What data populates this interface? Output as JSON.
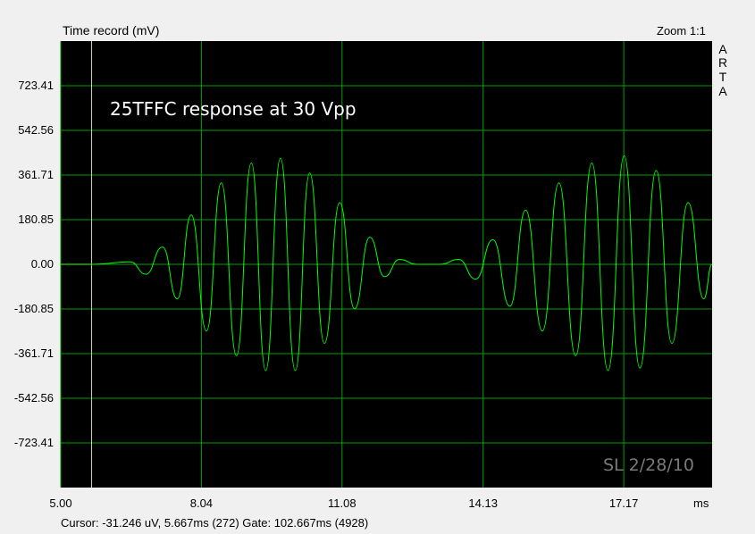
{
  "header": {
    "title": "Time record (mV)",
    "zoom": "Zoom 1:1"
  },
  "brand_letters": [
    "A",
    "R",
    "T",
    "A"
  ],
  "annotation": "25TFFC response at 30 Vpp",
  "signature": "SL 2/28/10",
  "xunit": "ms",
  "status": {
    "cursor": "Cursor: -31.246 uV, 5.667ms (272)  Gate: 102.667ms (4928)"
  },
  "colors": {
    "plot_bg": "#000000",
    "grid": "#00a000",
    "trace": "#00ff00",
    "cursor_line": "#d4d4aa",
    "pre_gate": "#e02020",
    "signature": "#7a7a7a"
  },
  "chart_data": {
    "type": "line",
    "title": "Time record (mV)",
    "xlabel": "ms",
    "ylabel": "",
    "xlim": [
      5.0,
      19.08
    ],
    "ylim": [
      -904.26,
      904.26
    ],
    "xticks": [
      "5.00",
      "8.04",
      "11.08",
      "14.13",
      "17.17"
    ],
    "yticks": [
      "723.41",
      "542.56",
      "361.71",
      "180.85",
      "0.00",
      "-180.85",
      "-361.71",
      "-542.56",
      "-723.41"
    ],
    "cursor_x": 5.667,
    "grid": true,
    "series": [
      {
        "name": "",
        "envelope": "two tone bursts (Hann-shaped)",
        "points": [
          [
            5.0,
            0
          ],
          [
            5.7,
            0
          ],
          [
            6.5,
            10
          ],
          [
            6.84,
            -40
          ],
          [
            7.2,
            70
          ],
          [
            7.52,
            -140
          ],
          [
            7.82,
            200
          ],
          [
            8.15,
            -270
          ],
          [
            8.47,
            330
          ],
          [
            8.8,
            -370
          ],
          [
            9.12,
            410
          ],
          [
            9.43,
            -430
          ],
          [
            9.75,
            430
          ],
          [
            10.07,
            -430
          ],
          [
            10.38,
            370
          ],
          [
            10.7,
            -320
          ],
          [
            11.03,
            250
          ],
          [
            11.35,
            -180
          ],
          [
            11.68,
            110
          ],
          [
            12.0,
            -50
          ],
          [
            12.32,
            20
          ],
          [
            12.7,
            0
          ],
          [
            13.2,
            0
          ],
          [
            13.6,
            20
          ],
          [
            13.97,
            -60
          ],
          [
            14.34,
            100
          ],
          [
            14.71,
            -170
          ],
          [
            15.05,
            220
          ],
          [
            15.41,
            -270
          ],
          [
            15.77,
            330
          ],
          [
            16.13,
            -370
          ],
          [
            16.48,
            410
          ],
          [
            16.83,
            -430
          ],
          [
            17.18,
            440
          ],
          [
            17.52,
            -420
          ],
          [
            17.87,
            380
          ],
          [
            18.21,
            -320
          ],
          [
            18.56,
            250
          ],
          [
            18.9,
            -140
          ],
          [
            19.08,
            0
          ]
        ]
      }
    ]
  }
}
